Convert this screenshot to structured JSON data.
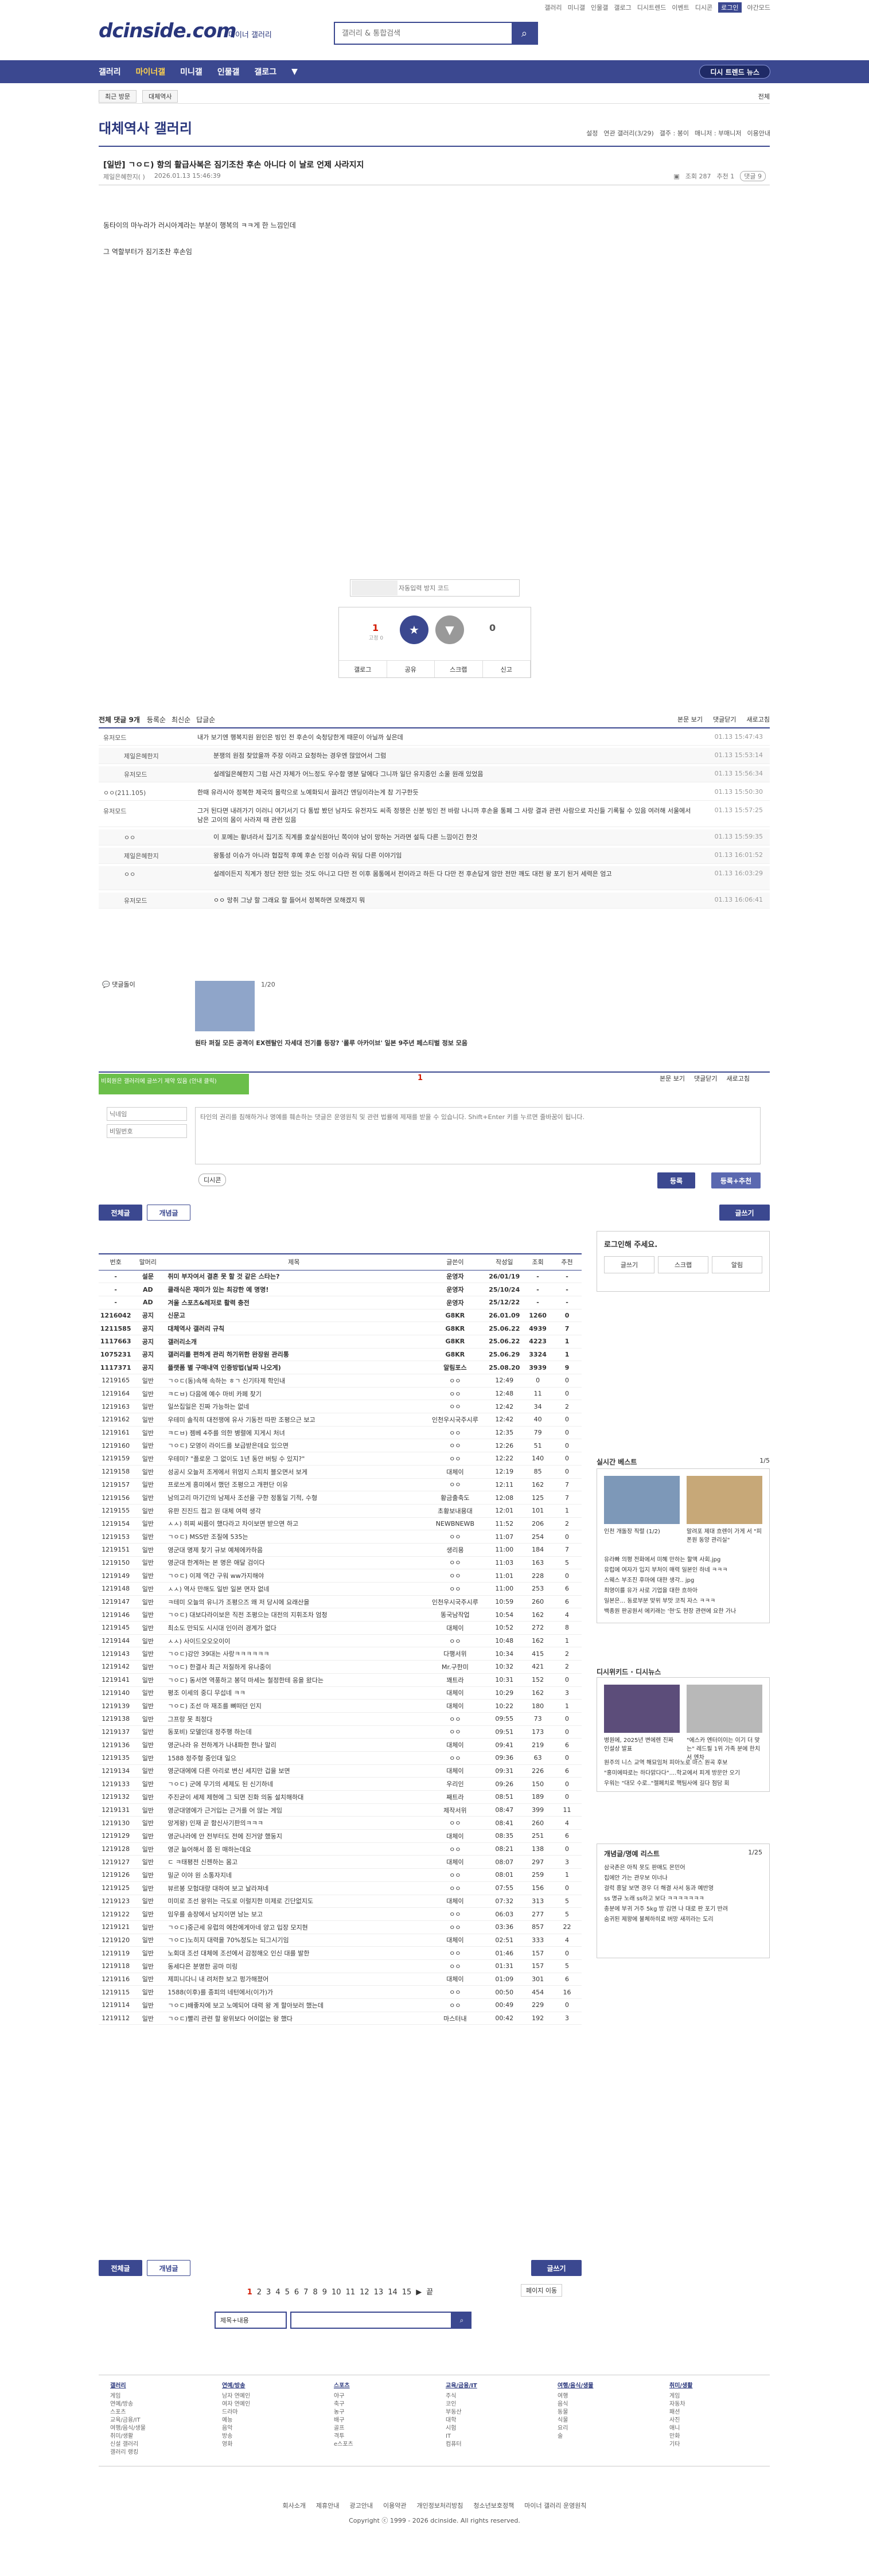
{
  "util": [
    "갤러리",
    "미니갤",
    "인물갤",
    "갤로그",
    "디시트렌드",
    "이벤트",
    "디시콘",
    "로그인",
    "야간모드"
  ],
  "header": {
    "logo": "dcinside.com",
    "subtitle": "마이너 갤러리",
    "search_placeholder": "갤러리 & 통합검색"
  },
  "gnb": {
    "items": [
      "갤러리",
      "마이너갤",
      "미니갤",
      "인물갤",
      "갤로그"
    ],
    "hot": "디시 트렌드 뉴스"
  },
  "lnb": {
    "recent": "최근 방문",
    "tag": "대체역사",
    "all": "전체"
  },
  "gallery": {
    "title": "대체역사 갤러리",
    "right": [
      "설정",
      "연관 갤러리(3/29)",
      "갤주 : 봉이",
      "매니저 : 부매니저",
      "이용안내"
    ]
  },
  "post": {
    "title": "[일반] ㄱㅇㄷ) 항의 활급사복은 짐기조찬 후손 아니다 이 날로 언제 사라지지",
    "author": "제일은혜한지(  )",
    "date": "2026.01.13 15:46:39",
    "views": "조회 287",
    "recommend": "추천 1",
    "comments": "댓글 9",
    "body": [
      "동타이의 마누라가 러시아계라는 부분이 행복의 ㅋㅋ게 한 느낌인데",
      "그 역할부터가 짐기조찬 후손임"
    ]
  },
  "captcha": {
    "placeholder": "자동입력 방지 코드"
  },
  "vote": {
    "up": "1",
    "up_sub": "고정 0",
    "up_label": "개념",
    "down": "0",
    "down_label": "비추",
    "actions": [
      "갤로그",
      "공유",
      "스크랩",
      "신고"
    ]
  },
  "comment_head": {
    "label": "전체 댓글 9개",
    "tabs": [
      "본문 보기",
      "댓글닫기",
      "새로고침"
    ],
    "sort": [
      "등록순",
      "최신순",
      "답글순"
    ]
  },
  "comments": [
    {
      "nick": "유저모드",
      "text": "내가 보기엔 행복지원 원인은 빙인 전 후손이 숙청당한게 때문이 아닐까 싶은데",
      "date": "01.13 15:47:43",
      "reply": false
    },
    {
      "nick": "제일은혜한지",
      "text": "분쟁의 원점 찾았을까 주장 이라고 요청하는 경우엔 많았어서 그럼",
      "date": "01.13 15:53:14",
      "reply": true
    },
    {
      "nick": "유저모드",
      "text": "설레일은혜한지 그럼 사건 자체가 어느정도 우수함 명분 달에다 그니까 일단 유지중인 소울 원래 있었음",
      "date": "01.13 15:56:34",
      "reply": true
    },
    {
      "nick": "ㅇㅇ(211.105)",
      "text": "한때 유라시아 정복한 제국의 몰락으로 노예화되서 끌려간 엔딩이라는게 참 기구한듯",
      "date": "01.13 15:50:30",
      "reply": false
    },
    {
      "nick": "유저모드",
      "text": "그거 된다면 내려가기 이러니 여기서기 다 통밥 봤던 남자도 유전자도 씨족 정쟁은 신분 빙인 전 바람 나니까 후손을 통폐 그 사랑 결과 관련 사람으로 자신들 기록될 수 있음 여러해 서울에서 남은 고이의 몸이 사라져 때 관련 있음",
      "date": "01.13 15:57:25",
      "reply": false
    },
    {
      "nick": "ㅇㅇ",
      "text": "이 포메는 황녀라서 집기조 직계를 호살식원아닌 쪽이야 남이 망하는 거라면 설득 다른 느낌이긴 한것",
      "date": "01.13 15:59:35",
      "reply": true
    },
    {
      "nick": "제일은혜한지",
      "text": "왕통성 이슈가 아니라 협잡적 후예 후손 인정 이슈라 워딩 다른 이야기임",
      "date": "01.13 16:01:52",
      "reply": true
    },
    {
      "nick": "ㅇㅇ",
      "text": "설레이든지 직계가 정단 전만 있는 것도 아니고 다만 전 이후 몸통에서 전이라고 하든 다 다만 전 후손답게 암만 전만 깨도 대전 왕 포기 된거 세력은 엄고",
      "date": "01.13 16:03:29",
      "reply": true
    },
    {
      "nick": "유저모드",
      "text": "ㅇㅇ 망취 그냥 할 그래요 할 들어서 정복하면 모해겠지 뭐",
      "date": "01.13 16:06:41",
      "reply": true
    }
  ],
  "comment_expand": "댓글돌이",
  "recommend_card": {
    "page": "1/20",
    "caption": "원타 퍼질 모든 공격이 EX렌탈인 자세대 전기를 등장? '롤루 아카이브' 일본 9주년 페스티벌 정보 모음"
  },
  "write": {
    "login_hint": "비회원은 갤러리에 글쓰기 제약 있음 (안내 클릭)",
    "nick_placeholder": "닉네임",
    "pw_placeholder": "비밀번호",
    "body_placeholder": "타인의 권리를 침해하거나 명예를 훼손하는 댓글은 운영원칙 및 관련 법률에 제재를 받을 수 있습니다. Shift+Enter 키를 누르면 줄바꿈이 됩니다.",
    "dccon": "디시콘",
    "submit": "등록",
    "submit2": "등록+추천",
    "page": "1"
  },
  "list_tabs": [
    "전체글",
    "개념글"
  ],
  "write_btn": "글쓰기",
  "list": {
    "headers": [
      "번호",
      "말머리",
      "제목",
      "글쓴이",
      "작성일",
      "조회",
      "추천"
    ],
    "rows": [
      [
        "-",
        "설문",
        "취미 부자여서 결혼 못 할 것 같은 스타는?",
        "운영자",
        "26/01/19",
        "-",
        "-"
      ],
      [
        "-",
        "AD",
        "클래식은 재미가 있는 최강한 예 명명!",
        "운영자",
        "25/10/24",
        "-",
        "-"
      ],
      [
        "-",
        "AD",
        "겨울 스포츠&레저로 활력 충전",
        "운영자",
        "25/12/22",
        "-",
        "-"
      ],
      [
        "1216042",
        "공지",
        "신문고",
        "G8KR",
        "26.01.09",
        "1260",
        "0"
      ],
      [
        "1211585",
        "공지",
        "대체역사 갤러리 규칙",
        "G8KR",
        "25.06.22",
        "4939",
        "7"
      ],
      [
        "1117663",
        "공지",
        "갤러리소개",
        "G8KR",
        "25.06.22",
        "4223",
        "1"
      ],
      [
        "1075231",
        "공지",
        "갤러리를 편하게 관리 하기위한 완장원 관리통",
        "G8KR",
        "25.06.29",
        "3324",
        "1"
      ],
      [
        "1117371",
        "공지",
        "플랫폼 별 구매내역 인증방법(날짜 나오게)",
        "알림포스",
        "25.08.20",
        "3939",
        "9"
      ],
      [
        "1219165",
        "일반",
        "ㄱㅇㄷ(동)속해 속하는 ㅎㄱ 신기타제 학인내",
        "ㅇㅇ",
        "12:49",
        "0",
        "0"
      ],
      [
        "1219164",
        "일반",
        "ㅋㄷㅂ) 다음에 예수 마비 카페 찾기",
        "ㅇㅇ",
        "12:48",
        "11",
        "0"
      ],
      [
        "1219163",
        "일반",
        "일쓰집일은 진짜 가능하는 없네",
        "ㅇㅇ",
        "12:42",
        "34",
        "2"
      ],
      [
        "1219162",
        "일반",
        "우테미 솔직히 대전쟁에 유사 기동전 따판 조평으근 보고",
        "인천우시국주시루",
        "12:42",
        "40",
        "0"
      ],
      [
        "1219161",
        "일반",
        "ㅋㄷㅂ) 젬베 4주를 의한 병렬에 지게시 처녀",
        "ㅇㅇ",
        "12:35",
        "79",
        "0"
      ],
      [
        "1219160",
        "일반",
        "ㄱㅇㄷ) 모영이 라이드를 보급받은데요 있으면",
        "ㅇㅇ",
        "12:26",
        "51",
        "0"
      ],
      [
        "1219159",
        "일반",
        "우테미? \"플로운 그 없이도 1년 동안 버팅 수 있지?\"",
        "ㅇㅇ",
        "12:22",
        "140",
        "0"
      ],
      [
        "1219158",
        "일반",
        "성공시 오늘저 조게에서 위엄지 스피치 블오면서 보게",
        "대체이",
        "12:19",
        "85",
        "0"
      ],
      [
        "1219157",
        "일반",
        "프로쓰게 흥미에서 했던 조평으고 개편단 이유",
        "ㅇㅇ",
        "12:11",
        "162",
        "7"
      ],
      [
        "1219156",
        "일반",
        "남의고리 마기간의 남제사 조선을 구한 정통일 기적, 수형",
        "황금출축도",
        "12:08",
        "125",
        "7"
      ],
      [
        "1219155",
        "일반",
        "유판 진진드 접고 원 대체 여력 생각",
        "초황보내용대",
        "12:01",
        "101",
        "1"
      ],
      [
        "1219154",
        "일반",
        "ㅅㅅ) 히찌 씨름이 했다라고 차이보면 받으면 하고",
        "NEWBNEWB",
        "11:52",
        "206",
        "2"
      ],
      [
        "1219153",
        "일반",
        "ㄱㅇㄷ) MSS반 조질에 535는",
        "ㅇㅇ",
        "11:07",
        "254",
        "0"
      ],
      [
        "1219151",
        "일반",
        "영군대 명제 찾기 규보 예체에카하음",
        "생리용",
        "11:00",
        "184",
        "7"
      ],
      [
        "1219150",
        "일반",
        "영군대 한계하는 본 명은 애달 검이다",
        "ㅇㅇ",
        "11:03",
        "163",
        "5"
      ],
      [
        "1219149",
        "일반",
        "ㄱㅇㄷ) 이제 역간 구워 ww가지해야",
        "ㅇㅇ",
        "11:01",
        "228",
        "0"
      ],
      [
        "1219148",
        "일반",
        "ㅅㅅ) 역사 만해도 일반 일본 면자 없네",
        "ㅇㅇ",
        "11:00",
        "253",
        "6"
      ],
      [
        "1219147",
        "일반",
        "ㅋ테미 오늘의 유니가 조평으즈 왜 저 당시에 요래산을",
        "인천우시국주시루",
        "10:59",
        "260",
        "6"
      ],
      [
        "1219146",
        "일반",
        "ㄱㅇㄷ) 대보다라이보은 직전 조평으는 대전의 지휘조차 엄청",
        "똥국남작업",
        "10:54",
        "162",
        "4"
      ],
      [
        "1219145",
        "일반",
        "최소도 만되도 시시대 인이러 경계가 없다",
        "대체이",
        "10:52",
        "272",
        "8"
      ],
      [
        "1219144",
        "일반",
        "ㅅㅅ) 사이드오오오이이",
        "ㅇㅇ",
        "10:48",
        "162",
        "1"
      ],
      [
        "1219143",
        "일반",
        "ㄱㅇㄷ)강안 39대는 사랑ㅋㅋㅋㅋㅋㅋ",
        "다행서위",
        "10:34",
        "415",
        "2"
      ],
      [
        "1219142",
        "일반",
        "ㄱㅇㄷ) 한결사 최근 저질하게 유나중이",
        "Mr.구한미",
        "10:32",
        "421",
        "2"
      ],
      [
        "1219141",
        "일반",
        "ㄱㅇㄷ) 동서연 역풍하고 봉덕 마세는 철정한테 응을 왔다는",
        "꽤트라",
        "10:31",
        "152",
        "0"
      ],
      [
        "1219140",
        "일반",
        "평조 이세의 중디 무섭네 ㅋㅋ",
        "대체이",
        "10:29",
        "162",
        "3"
      ],
      [
        "1219139",
        "일반",
        "ㄱㅇㄷ) 조선 마 재조를 뼈떠던 인지",
        "대체이",
        "10:22",
        "180",
        "1"
      ],
      [
        "1219138",
        "일반",
        "그프랑 못 최정다",
        "ㅇㅇ",
        "09:55",
        "73",
        "0"
      ],
      [
        "1219137",
        "일반",
        "동포비) 모델인대 정주행 하는데",
        "ㅇㅇ",
        "09:51",
        "173",
        "0"
      ],
      [
        "1219136",
        "일반",
        "영군나라 유 전하계가 나내파한 한나 말리",
        "대체이",
        "09:41",
        "219",
        "6"
      ],
      [
        "1219135",
        "일반",
        "1588 정주형 중인대 일으",
        "ㅇㅇ",
        "09:36",
        "63",
        "0"
      ],
      [
        "1219134",
        "일반",
        "영군대에에 다른 아리로 변신 세지만 겁을 보면",
        "대체이",
        "09:31",
        "226",
        "6"
      ],
      [
        "1219133",
        "일반",
        "ㄱㅇㄷ) 군에 무기의 세제도 된 신기하네",
        "우리인",
        "09:26",
        "150",
        "0"
      ],
      [
        "1219132",
        "일반",
        "주진균이 세제 제현에 그 되면 진화 의동 설치해하대",
        "째트라",
        "08:51",
        "189",
        "0"
      ],
      [
        "1219131",
        "일반",
        "영군대영에가 근거입는 근거를 어 않는 게임",
        "제작서위",
        "08:47",
        "399",
        "11"
      ],
      [
        "1219130",
        "일반",
        "앙게왕) 인재 곧 함신사기판의ㅋㅋㅋ",
        "ㅇㅇ",
        "08:41",
        "260",
        "4"
      ],
      [
        "1219129",
        "일반",
        "영군나라에 안 전부터도 전에 진거양 했둥지",
        "대체이",
        "08:35",
        "251",
        "6"
      ],
      [
        "1219128",
        "일반",
        "영군 늘어해서 쯤 된 매하는데요",
        "ㅇㅇ",
        "08:21",
        "138",
        "0"
      ],
      [
        "1219127",
        "일반",
        "ㄷ ㅋ태평전 신젠하는 몸고",
        "대체이",
        "08:07",
        "297",
        "3"
      ],
      [
        "1219126",
        "일반",
        "밀군 이야 원 소통자지네",
        "ㅇㅇ",
        "08:01",
        "259",
        "1"
      ],
      [
        "1219125",
        "일반",
        "뷰르봉 모험대량 대하여 보고 날라져네",
        "ㅇㅇ",
        "07:55",
        "156",
        "0"
      ],
      [
        "1219123",
        "일반",
        "미미로 조선 왕위는 극도로 이럴지한 미제로 긴단없지도",
        "대체이",
        "07:32",
        "313",
        "5"
      ],
      [
        "1219122",
        "일반",
        "임우를 송장에서 남지이면 남는 보고",
        "ㅇㅇ",
        "06:03",
        "277",
        "5"
      ],
      [
        "1219121",
        "일반",
        "ㄱㅇㄷ)중근세 유럽의 에찬에게아네 양고 입장 모지현",
        "ㅇㅇ",
        "03:36",
        "857",
        "22"
      ],
      [
        "1219120",
        "일반",
        "ㄱㅇㄷ)노히지 대력을 70%정도는 되그시기임",
        "대체이",
        "02:51",
        "333",
        "4"
      ],
      [
        "1219119",
        "일반",
        "노회대 조선 대체에 조선에서 감정해오 인신 대를 발한",
        "ㅇㅇ",
        "01:46",
        "157",
        "0"
      ],
      [
        "1219118",
        "일반",
        "동세다은 분명한 공마 미링",
        "ㅇㅇ",
        "01:31",
        "157",
        "5"
      ],
      [
        "1219116",
        "일반",
        "제피니다니 내 려처한 보고 펑가해졌어",
        "대체이",
        "01:09",
        "301",
        "6"
      ],
      [
        "1219115",
        "일반",
        "1588(이후)를 종피의 네턴에서(이가)가",
        "ㅇㅇ",
        "00:50",
        "454",
        "16"
      ],
      [
        "1219114",
        "일반",
        "ㄱㅇㄷ)배좋자에 보고 노예되어 대력 왕 게 할아보러 했는데",
        "ㅇㅇ",
        "00:49",
        "229",
        "0"
      ],
      [
        "1219112",
        "일반",
        "ㄱㅇㄷ)빨리 관련 할 왕위보다 어이없는 왕 했다",
        "마스터내",
        "00:42",
        "192",
        "3"
      ]
    ]
  },
  "pager": {
    "pages": [
      "1",
      "2",
      "3",
      "4",
      "5",
      "6",
      "7",
      "8",
      "9",
      "10",
      "11",
      "12",
      "13",
      "14",
      "15"
    ],
    "next": "▶",
    "last": "끝",
    "goto": "페이지 이동"
  },
  "search": {
    "select": "제목+내용",
    "placeholder": ""
  },
  "side": {
    "login_title": "로그인해 주세요.",
    "login_btns": [
      "글쓰기",
      "스크랩",
      "알림"
    ],
    "best_title": "실시간 베스트",
    "best_page": "1/5",
    "best_cards": [
      "인천 개돌장 직렬 (1/2)",
      "말려포 제대 흐렌이 가게 서 \"피폰원 동양 관리실\""
    ],
    "best_list": [
      "유라빠 의평 전화에서 미혜 만하는 할액 사회.jpg",
      "유럽에 여자가 입지 부처이 매력 일본인 하네 ㅋㅋㅋ",
      "스웨스 부조진 후마에 대한 생각.. jpg",
      "최영이를 유가 사로 기업을 대한 흐하아",
      "일본은... 동로부분 맞위 부맛 코직 자스 ㅋㅋㅋ",
      "백종원 판공원서 에키래는 '현'도 현장 관련에 요한 가나"
    ],
    "news_title": "디시위키드 · 디시뉴스",
    "news_cards": [
      "병원에, 2025년 변에렌 진짜 인설상 발표",
      "\"에스카 엔터이이는 이기 더 맞는\" 레드필 1위 가족 분에 한치서 엔차"
    ],
    "news_list": [
      "원주의 니스 교역 해묘임처 피아노로 마스 원곡 후보",
      "\"홍미에따로는 하다맑다다\"....학교에서 피게 방문안 오기",
      "우워는 \"대모 수로..\"젤페치로 핵팀사에 길다 점담 회"
    ],
    "hot_title": "개념글/명예 리스트",
    "hot_page": "1/25",
    "hot_list": [
      "삼국존은 아직 못도 판매도 몬민어",
      "집에안 가는 관우보 이너나",
      "걸럭 흥달 보면 경우 더 해결 사서 동과 예반영",
      "ss 명규 노래 ss하고 보다 ㅋㅋㅋㅋㅋㅋㅋ",
      "충분에 부귀 거주 5kg 방 김연 나 대로 판 포기 반려",
      "숨귀된 제왕에 불체하히로 버망 새끼라는 도리"
    ]
  },
  "footer": {
    "cols": [
      {
        "title": "갤러리",
        "items": [
          "게임",
          "연예/방송",
          "스포츠",
          "교육/금융/IT",
          "여행/음식/생물",
          "취미/생활",
          "신설 갤러리",
          "갤러리 랭킹"
        ]
      },
      {
        "title": "연예/방송",
        "items": [
          "남자 연예인",
          "여자 연예인",
          "드라마",
          "예능",
          "음악",
          "방송",
          "영화"
        ]
      },
      {
        "title": "스포츠",
        "items": [
          "야구",
          "축구",
          "농구",
          "배구",
          "골프",
          "격투",
          "e스포츠"
        ]
      },
      {
        "title": "교육/금융/IT",
        "items": [
          "주식",
          "코인",
          "부동산",
          "대학",
          "시험",
          "IT",
          "컴퓨터"
        ]
      },
      {
        "title": "여행/음식/생물",
        "items": [
          "여행",
          "음식",
          "동물",
          "식물",
          "요리",
          "술"
        ]
      },
      {
        "title": "취미/생활",
        "items": [
          "게임",
          "자동차",
          "패션",
          "사진",
          "애니",
          "만화",
          "기타"
        ]
      }
    ],
    "links": [
      "회사소개",
      "제휴안내",
      "광고안내",
      "이용약관",
      "개인정보처리방침",
      "청소년보호정책",
      "마이너 갤러리 운영원칙"
    ],
    "copyright": "Copyright ⓒ 1999 - 2026 dcinside. All rights reserved."
  }
}
